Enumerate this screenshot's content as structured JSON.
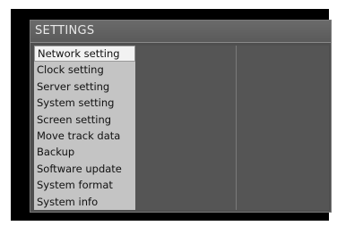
{
  "window": {
    "title": "SETTINGS"
  },
  "menu": {
    "selected_index": 0,
    "items": [
      {
        "label": "Network setting"
      },
      {
        "label": "Clock setting"
      },
      {
        "label": "Server setting"
      },
      {
        "label": "System setting"
      },
      {
        "label": "Screen setting"
      },
      {
        "label": "Move track data"
      },
      {
        "label": "Backup"
      },
      {
        "label": "Software update"
      },
      {
        "label": "System format"
      },
      {
        "label": "System info"
      }
    ]
  },
  "colors": {
    "screen_bg": "#000000",
    "panel_bg": "#4f4f4f",
    "menu_bg": "#c4c4c4",
    "selected_bg": "#f2f2f2",
    "title_text": "#e8e8e8"
  }
}
